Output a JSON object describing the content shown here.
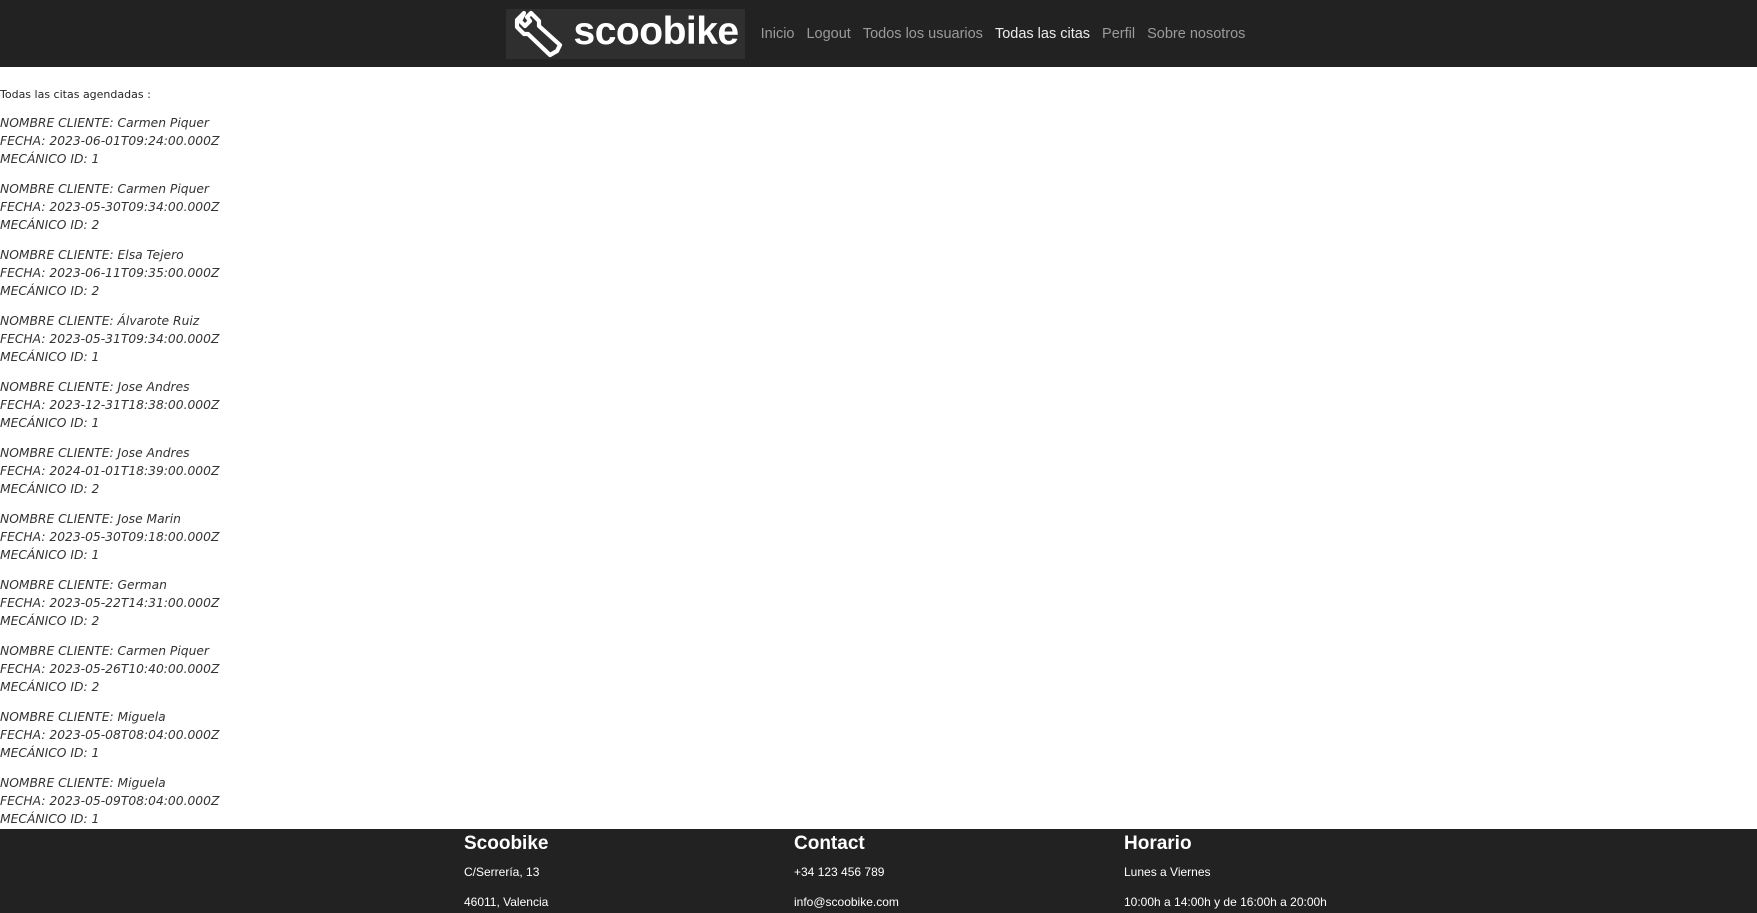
{
  "navbar": {
    "brand": "scoobike",
    "links": [
      "Inicio",
      "Logout",
      "Todos los usuarios",
      "Todas las citas",
      "Perfil",
      "Sobre nosotros"
    ]
  },
  "main": {
    "heading": "Todas las citas agendadas :",
    "appointments": [
      {
        "cliente": "NOMBRE CLIENTE: Carmen Piquer",
        "fecha": "FECHA: 2023-06-01T09:24:00.000Z",
        "mecanico": "MECÁNICO ID: 1"
      },
      {
        "cliente": "NOMBRE CLIENTE: Carmen Piquer",
        "fecha": "FECHA: 2023-05-30T09:34:00.000Z",
        "mecanico": "MECÁNICO ID: 2"
      },
      {
        "cliente": "NOMBRE CLIENTE: Elsa Tejero",
        "fecha": "FECHA: 2023-06-11T09:35:00.000Z",
        "mecanico": "MECÁNICO ID: 2"
      },
      {
        "cliente": "NOMBRE CLIENTE: Álvarote Ruiz",
        "fecha": "FECHA: 2023-05-31T09:34:00.000Z",
        "mecanico": "MECÁNICO ID: 1"
      },
      {
        "cliente": "NOMBRE CLIENTE: Jose Andres",
        "fecha": "FECHA: 2023-12-31T18:38:00.000Z",
        "mecanico": "MECÁNICO ID: 1"
      },
      {
        "cliente": "NOMBRE CLIENTE: Jose Andres",
        "fecha": "FECHA: 2024-01-01T18:39:00.000Z",
        "mecanico": "MECÁNICO ID: 2"
      },
      {
        "cliente": "NOMBRE CLIENTE: Jose Marin",
        "fecha": "FECHA: 2023-05-30T09:18:00.000Z",
        "mecanico": "MECÁNICO ID: 1"
      },
      {
        "cliente": "NOMBRE CLIENTE: German",
        "fecha": "FECHA: 2023-05-22T14:31:00.000Z",
        "mecanico": "MECÁNICO ID: 2"
      },
      {
        "cliente": "NOMBRE CLIENTE: Carmen Piquer",
        "fecha": "FECHA: 2023-05-26T10:40:00.000Z",
        "mecanico": "MECÁNICO ID: 2"
      },
      {
        "cliente": "NOMBRE CLIENTE: Miguela",
        "fecha": "FECHA: 2023-05-08T08:04:00.000Z",
        "mecanico": "MECÁNICO ID: 1"
      },
      {
        "cliente": "NOMBRE CLIENTE: Miguela",
        "fecha": "FECHA: 2023-05-09T08:04:00.000Z",
        "mecanico": "MECÁNICO ID: 1"
      }
    ]
  },
  "footer": {
    "columns": [
      {
        "title": "Scoobike",
        "line1": "C/Serrería, 13",
        "line2": "46011, Valencia"
      },
      {
        "title": "Contact",
        "line1": "+34 123 456 789",
        "line2": "info@scoobike.com"
      },
      {
        "title": "Horario",
        "line1": "Lunes a Viernes",
        "line2": "10:00h a 14:00h y de 16:00h a 20:00h"
      }
    ]
  },
  "icons": {
    "logo": "wrench-icon"
  },
  "colors": {
    "navbar_bg": "#222222",
    "footer_bg": "#222222",
    "brand_bg": "#2f2f2f",
    "nav_link": "#9a9a9a",
    "nav_link_active": "#ececec"
  }
}
